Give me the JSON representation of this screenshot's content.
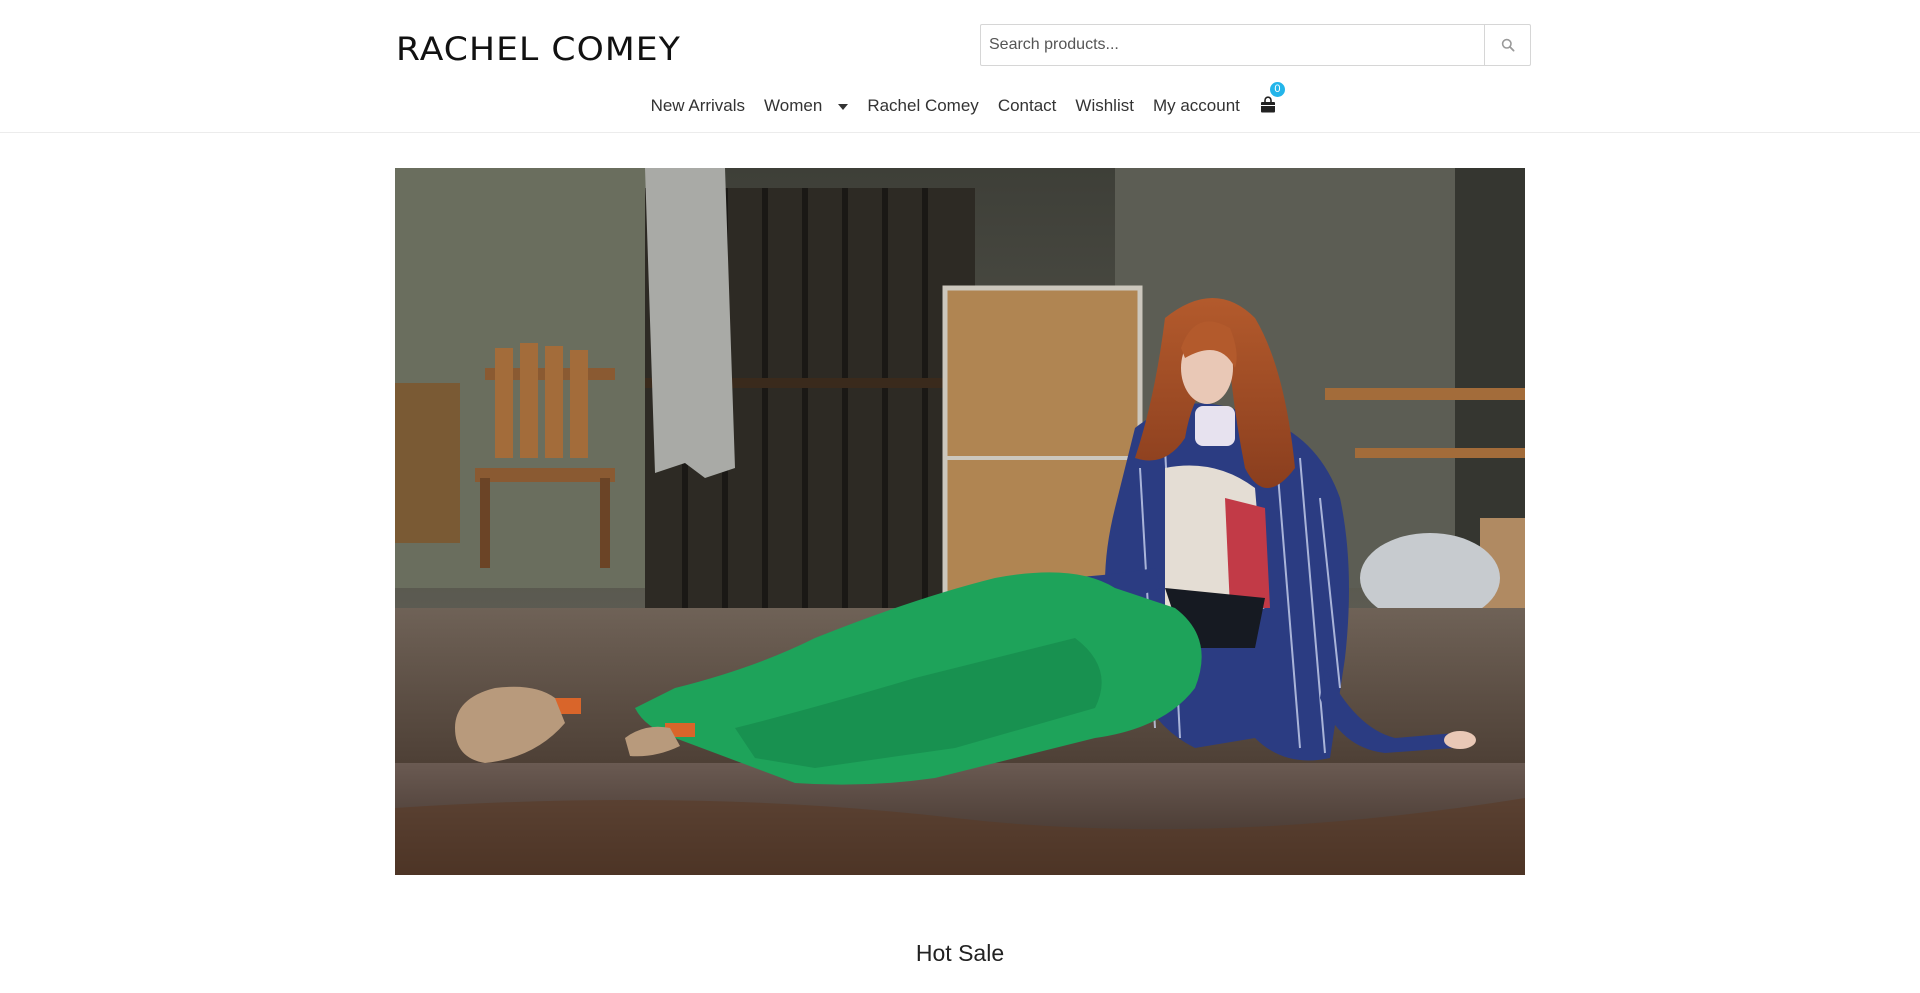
{
  "header": {
    "logo_text": "RACHEL COMEY",
    "search": {
      "placeholder": "Search products...",
      "button_icon": "search-icon"
    }
  },
  "nav": {
    "items": [
      {
        "label": "New Arrivals"
      },
      {
        "label": "Women",
        "has_dropdown": true
      },
      {
        "label": "Rachel Comey"
      },
      {
        "label": "Contact"
      },
      {
        "label": "Wishlist"
      },
      {
        "label": "My account"
      }
    ],
    "cart": {
      "icon": "shopping-bag-icon",
      "count": "0",
      "badge_color": "#23b5ea"
    }
  },
  "hero": {
    "image_subject": "hero-banner-image"
  },
  "sections": {
    "hot_sale_title": "Hot Sale"
  }
}
